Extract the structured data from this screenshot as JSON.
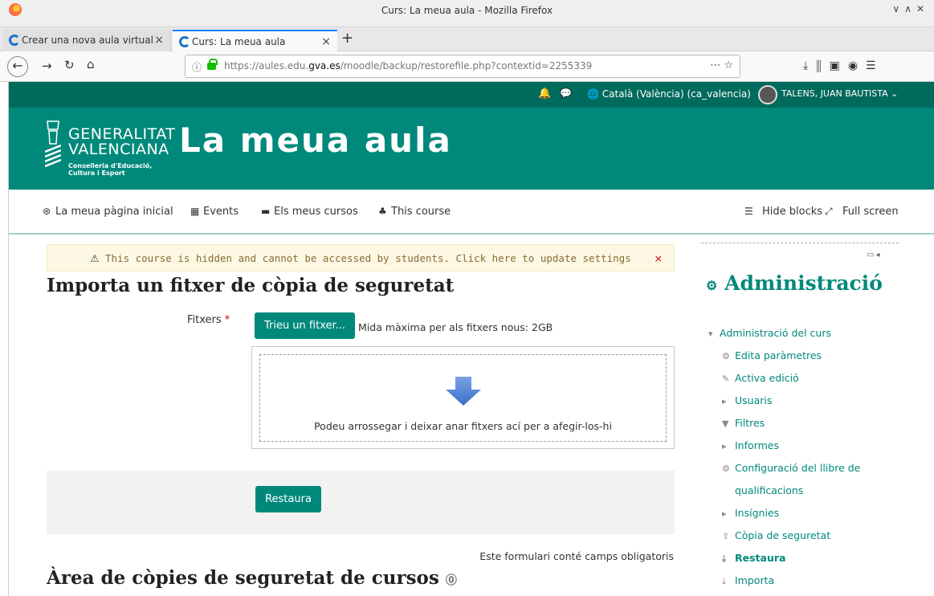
{
  "browser": {
    "window_title": "Curs: La meua aula - Mozilla Firefox",
    "tabs": [
      {
        "label": "Crear una nova aula virtual"
      },
      {
        "label": "Curs: La meua aula"
      }
    ],
    "url_gray_prefix": "https://aules.edu.",
    "url_host": "gva.es",
    "url_path": "/moodle/backup/restorefile.php?contextid=2255339"
  },
  "topbar": {
    "language": "Català (València) (ca_valencia)",
    "user": "TALENS, JUAN BAUTISTA"
  },
  "banner": {
    "org_line1": "GENERALITAT",
    "org_line2": "VALENCIANA",
    "dept_line1": "Conselleria d'Educació,",
    "dept_line2": "Cultura i Esport",
    "site_name": "La meua aula"
  },
  "menu": {
    "home": "La meua pàgina inicial",
    "events": "Events",
    "my_courses": "Els meus cursos",
    "this_course": "This course",
    "hide_blocks": "Hide blocks",
    "full_screen": "Full screen"
  },
  "alert": {
    "text": "This course is hidden and cannot be accessed by students. Click here to update settings",
    "close": "×"
  },
  "import": {
    "heading": "Importa un fitxer de còpia de seguretat",
    "files_label": "Fitxers",
    "required_mark": "*",
    "choose_button": "Trieu un fitxer...",
    "max_size": "Mida màxima per als fitxers nous: 2GB",
    "drop_text": "Podeu arrossegar i deixar anar fitxers ací per a afegir-los-hi",
    "restore_button": "Restaura",
    "required_note": "Este formulari conté camps obligatoris"
  },
  "backup_area": {
    "heading": "Àrea de còpies de seguretat de cursos"
  },
  "admin": {
    "title": "Administració",
    "items": [
      {
        "label": "Administració del curs",
        "icon": "caret-down-icon"
      },
      {
        "label": "Edita paràmetres",
        "icon": "gear-icon"
      },
      {
        "label": "Activa edició",
        "icon": "pencil-icon"
      },
      {
        "label": "Usuaris",
        "icon": "caret-right-icon"
      },
      {
        "label": "Filtres",
        "icon": "filter-icon"
      },
      {
        "label": "Informes",
        "icon": "caret-right-icon"
      },
      {
        "label": "Configuració del llibre de",
        "icon": "gear-icon"
      },
      {
        "label": "qualificacions",
        "icon": ""
      },
      {
        "label": "Insígnies",
        "icon": "caret-right-icon"
      },
      {
        "label": "Còpia de seguretat",
        "icon": "upload-icon"
      },
      {
        "label": "Restaura",
        "icon": "download-icon"
      },
      {
        "label": "Importa",
        "icon": "download-icon"
      }
    ]
  },
  "colors": {
    "brand_dark": "#006a5c",
    "brand": "#00897b",
    "alert_bg": "#fcf8e3",
    "alert_text": "#8a6d3b"
  }
}
